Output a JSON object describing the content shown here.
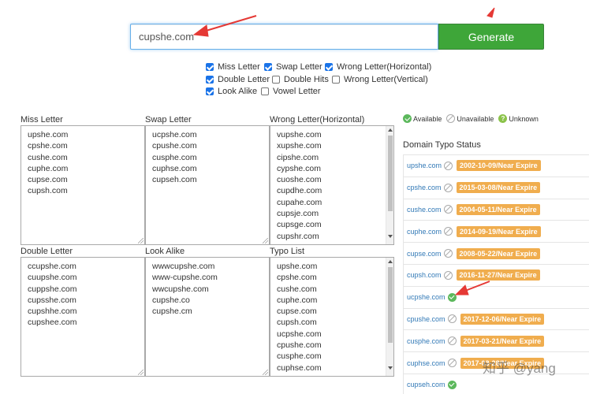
{
  "search": {
    "value": "cupshe.com"
  },
  "generate_label": "Generate",
  "options": [
    {
      "label": "Miss Letter",
      "checked": true
    },
    {
      "label": "Swap Letter",
      "checked": true
    },
    {
      "label": "Wrong Letter(Horizontal)",
      "checked": true
    },
    {
      "label": "Double Letter",
      "checked": true
    },
    {
      "label": "Double Hits",
      "checked": false
    },
    {
      "label": "Wrong Letter(Vertical)",
      "checked": false
    },
    {
      "label": "Look Alike",
      "checked": true
    },
    {
      "label": "Vowel Letter",
      "checked": false
    }
  ],
  "panels": [
    {
      "title": "Miss Letter",
      "items": [
        "upshe.com",
        "cpshe.com",
        "cushe.com",
        "cuphe.com",
        "cupse.com",
        "cupsh.com"
      ],
      "scroll": false
    },
    {
      "title": "Swap Letter",
      "items": [
        "ucpshe.com",
        "cpushe.com",
        "cusphe.com",
        "cuphse.com",
        "cupseh.com"
      ],
      "scroll": false
    },
    {
      "title": "Wrong Letter(Horizontal)",
      "items": [
        "vupshe.com",
        "xupshe.com",
        "cipshe.com",
        "cypshe.com",
        "cuoshe.com",
        "cupdhe.com",
        "cupahe.com",
        "cupsje.com",
        "cupsge.com",
        "cupshr.com"
      ],
      "scroll": true
    },
    {
      "title": "Double Letter",
      "items": [
        "ccupshe.com",
        "cuupshe.com",
        "cuppshe.com",
        "cupsshe.com",
        "cupshhe.com",
        "cupshee.com"
      ],
      "scroll": false
    },
    {
      "title": "Look Alike",
      "items": [
        "wwwcupshe.com",
        "www-cupshe.com",
        "wwcupshe.com",
        "cupshe.co",
        "cupshe.cm"
      ],
      "scroll": false
    },
    {
      "title": "Typo List",
      "items": [
        "upshe.com",
        "cpshe.com",
        "cushe.com",
        "cuphe.com",
        "cupse.com",
        "cupsh.com",
        "ucpshe.com",
        "cpushe.com",
        "cusphe.com",
        "cuphse.com"
      ],
      "scroll": true
    }
  ],
  "legend": {
    "available": "Available",
    "unavailable": "Unavailable",
    "unknown": "Unknown"
  },
  "status_title": "Domain Typo Status",
  "status_rows": [
    {
      "domain": "upshe.com",
      "state": "unavailable",
      "badge": "2002-10-09/Near Expire"
    },
    {
      "domain": "cpshe.com",
      "state": "unavailable",
      "badge": "2015-03-08/Near Expire"
    },
    {
      "domain": "cushe.com",
      "state": "unavailable",
      "badge": "2004-05-11/Near Expire"
    },
    {
      "domain": "cuphe.com",
      "state": "unavailable",
      "badge": "2014-09-19/Near Expire"
    },
    {
      "domain": "cupse.com",
      "state": "unavailable",
      "badge": "2008-05-22/Near Expire"
    },
    {
      "domain": "cupsh.com",
      "state": "unavailable",
      "badge": "2016-11-27/Near Expire"
    },
    {
      "domain": "ucpshe.com",
      "state": "available",
      "badge": ""
    },
    {
      "domain": "cpushe.com",
      "state": "unavailable",
      "badge": "2017-12-06/Near Expire"
    },
    {
      "domain": "cusphe.com",
      "state": "unavailable",
      "badge": "2017-03-21/Near Expire"
    },
    {
      "domain": "cuphse.com",
      "state": "unavailable",
      "badge": "2017-03-28/Near Expire"
    },
    {
      "domain": "cupseh.com",
      "state": "available",
      "badge": ""
    }
  ],
  "watermark": "知乎 @yang",
  "colors": {
    "generate": "#3ea639",
    "badge": "#f0ad4e",
    "link": "#337ab7",
    "annotation_arrow": "#e53935"
  }
}
